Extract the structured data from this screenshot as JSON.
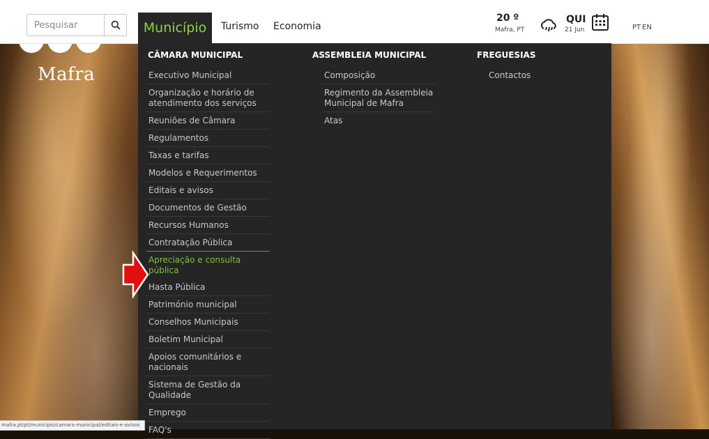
{
  "search": {
    "placeholder": "Pesquisar"
  },
  "nav": {
    "active": "Município",
    "items": [
      "Turismo",
      "Economia"
    ]
  },
  "weather": {
    "temp": "20 º",
    "location": "Mafra, PT"
  },
  "date": {
    "day": "QUI",
    "date": "21 Jun"
  },
  "lang": {
    "pt": "PT",
    "en": "EN"
  },
  "logo": {
    "text": "Mafra"
  },
  "menu": {
    "camara": {
      "title": "CÂMARA MUNICIPAL",
      "items": [
        "Executivo Municipal",
        "Organização e horário de atendimento dos serviços",
        "Reuniões de Câmara",
        "Regulamentos",
        "Taxas e tarifas",
        "Modelos e Requerimentos",
        "Editais e avisos",
        "Documentos de Gestão",
        "Recursos Humanos",
        "Contratação Pública",
        "Apreciação e consulta pública",
        "Hasta Pública",
        "Património municipal",
        "Conselhos Municipais",
        "Boletim Municipal",
        "Apoios comunitários e nacionais",
        "Sistema de Gestão da Qualidade",
        "Emprego",
        "FAQ's"
      ]
    },
    "assembleia": {
      "title": "ASSEMBLEIA MUNICIPAL",
      "items": [
        "Composição",
        "Regimento da Assembleia Municipal de Mafra",
        "Atas"
      ]
    },
    "freguesias": {
      "title": "FREGUESIAS",
      "items": [
        "Contactos"
      ]
    }
  },
  "status_url": "mafra.pt/pt/municipio/camara-municipal/editais-e-avisos",
  "colors": {
    "active_green": "#7fc045",
    "menu_bg": "#252525",
    "arrow_red": "#e0100e"
  }
}
